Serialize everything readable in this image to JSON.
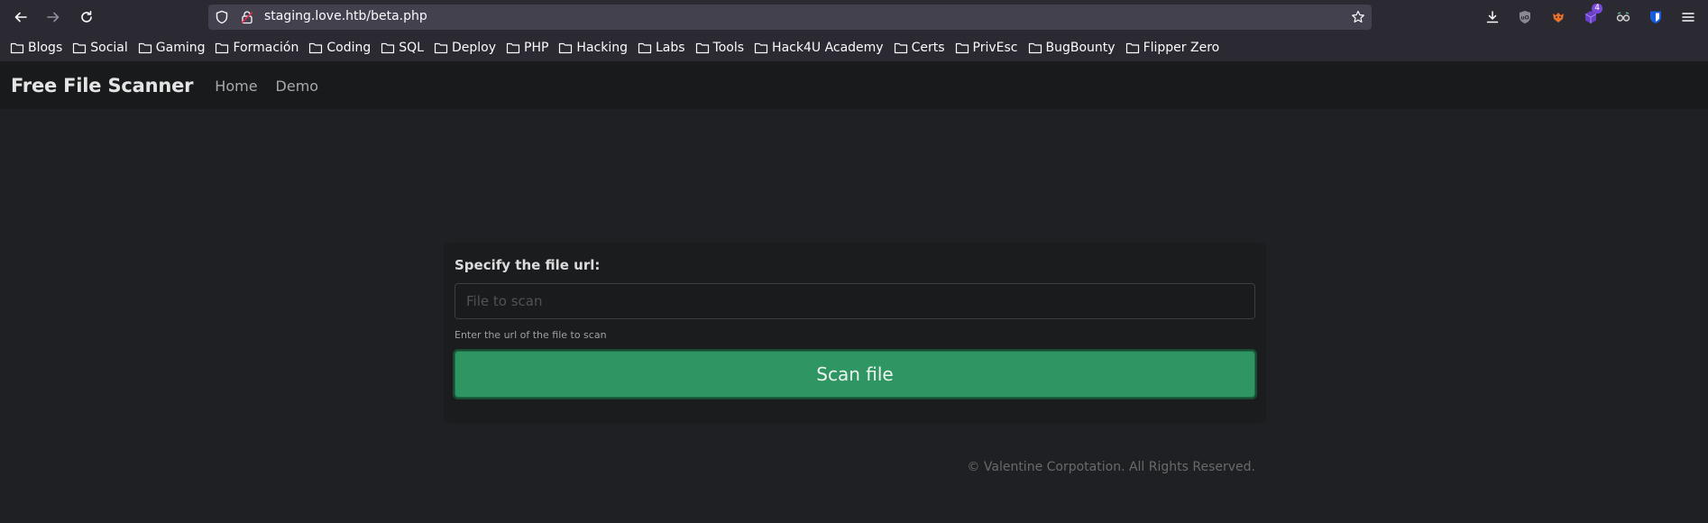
{
  "browser": {
    "url": "staging.love.htb/beta.php",
    "extension_badge": "4",
    "bookmarks": [
      "Blogs",
      "Social",
      "Gaming",
      "Formación",
      "Coding",
      "SQL",
      "Deploy",
      "PHP",
      "Hacking",
      "Labs",
      "Tools",
      "Hack4U Academy",
      "Certs",
      "PrivEsc",
      "BugBounty",
      "Flipper Zero"
    ]
  },
  "site": {
    "brand": "Free File Scanner",
    "nav": [
      "Home",
      "Demo"
    ]
  },
  "form": {
    "label": "Specify the file url:",
    "input_value": "",
    "input_placeholder": "File to scan",
    "help_text": "Enter the url of the file to scan",
    "submit_label": "Scan file"
  },
  "footer": {
    "text": "© Valentine Corpotation. All Rights Reserved."
  },
  "colors": {
    "page_bg": "#1f2023",
    "nav_bg": "#191a1c",
    "button_green": "#2e9563",
    "browser_chrome": "#2b2a33"
  }
}
